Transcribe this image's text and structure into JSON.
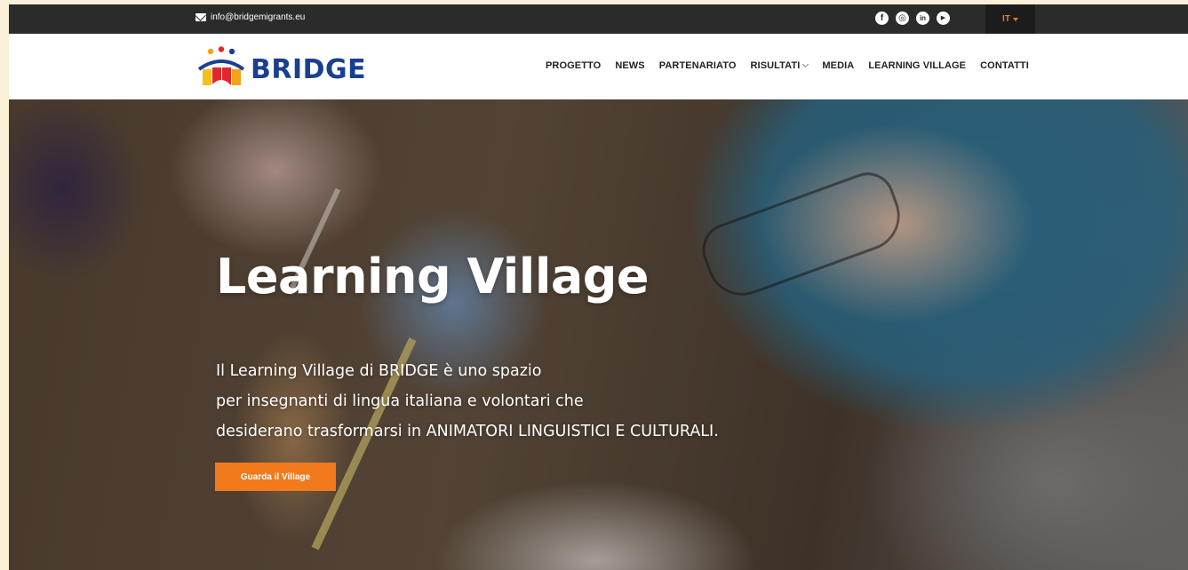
{
  "topbar": {
    "email": "info@bridgemigrants.eu",
    "socials": [
      {
        "icon": "facebook-icon",
        "glyph": "f"
      },
      {
        "icon": "instagram-icon",
        "glyph": "◎"
      },
      {
        "icon": "linkedin-icon",
        "glyph": "in"
      },
      {
        "icon": "youtube-icon",
        "glyph": "▶"
      }
    ],
    "language": "IT"
  },
  "header": {
    "logo_text": "BRIDGE",
    "nav": [
      {
        "label": "PROGETTO"
      },
      {
        "label": "NEWS"
      },
      {
        "label": "PARTENARIATO"
      },
      {
        "label": "RISULTATI",
        "has_dropdown": true
      },
      {
        "label": "MEDIA"
      },
      {
        "label": "LEARNING VILLAGE"
      },
      {
        "label": "CONTATTI"
      }
    ]
  },
  "hero": {
    "title": "Learning Village",
    "lines": [
      "Il Learning Village di BRIDGE è uno spazio",
      "per insegnanti di lingua italiana e volontari che",
      "desiderano trasformarsi in ANIMATORI LINGUISTICI E CULTURALI."
    ],
    "cta_label": "Guarda il Village"
  },
  "colors": {
    "accent": "#f07a1c",
    "topbar": "#2b2b2b",
    "logo_blue": "#1b3f8f"
  }
}
